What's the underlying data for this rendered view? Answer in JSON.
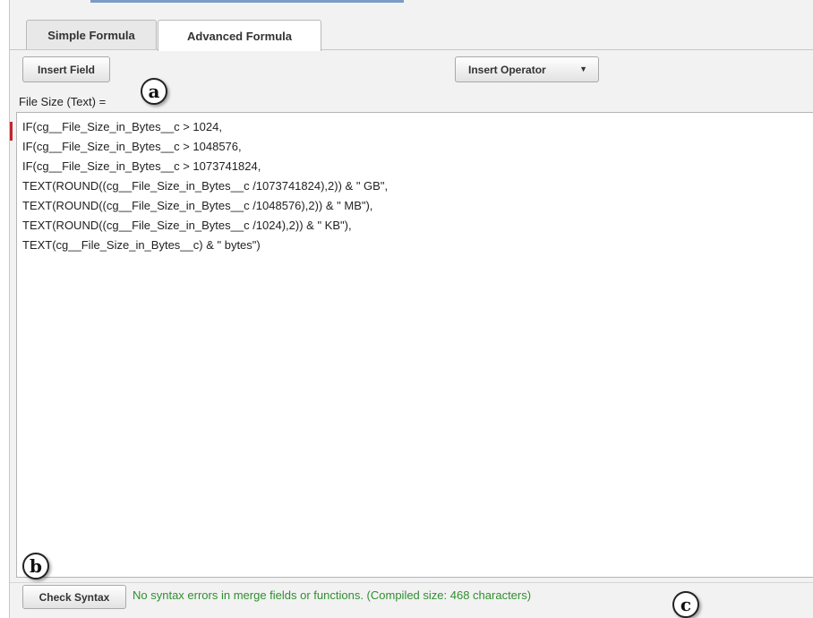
{
  "tabs": [
    {
      "label": "Simple Formula",
      "active": false
    },
    {
      "label": "Advanced Formula",
      "active": true
    }
  ],
  "toolbar": {
    "insert_field_label": "Insert Field",
    "insert_operator_label": "Insert Operator",
    "insert_operator_caret": "▼"
  },
  "field_label": "File Size (Text) =",
  "editor": {
    "lines": [
      "IF(cg__File_Size_in_Bytes__c > 1024,",
      "IF(cg__File_Size_in_Bytes__c > 1048576,",
      "IF(cg__File_Size_in_Bytes__c > 1073741824,",
      "TEXT(ROUND((cg__File_Size_in_Bytes__c /1073741824),2)) & \" GB\",",
      "TEXT(ROUND((cg__File_Size_in_Bytes__c /1048576),2)) & \" MB\"),",
      "TEXT(ROUND((cg__File_Size_in_Bytes__c /1024),2)) & \" KB\"),",
      "TEXT(cg__File_Size_in_Bytes__c) & \" bytes\")"
    ]
  },
  "footer": {
    "check_syntax_label": "Check Syntax",
    "status_text": "No syntax errors in merge fields or functions. (Compiled size: 468 characters)",
    "status_color": "#2f8f2f"
  },
  "callouts": {
    "a": "a",
    "b": "b",
    "c": "c"
  }
}
